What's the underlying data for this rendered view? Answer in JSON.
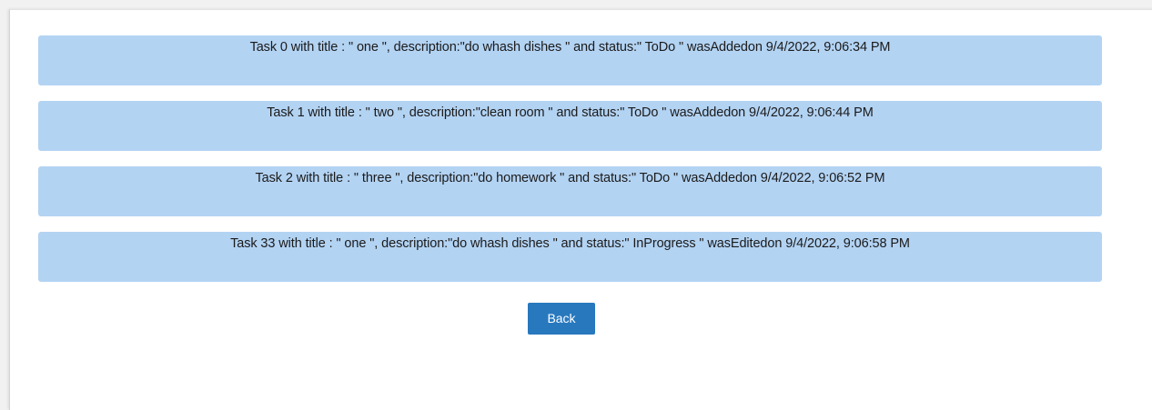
{
  "tasks": [
    {
      "text": "Task 0 with title : \" one \", description:\"do whash dishes \" and status:\" ToDo \" wasAddedon 9/4/2022, 9:06:34 PM"
    },
    {
      "text": "Task 1 with title : \" two \", description:\"clean room \" and status:\" ToDo \" wasAddedon 9/4/2022, 9:06:44 PM"
    },
    {
      "text": "Task 2 with title : \" three \", description:\"do homework \" and status:\" ToDo \" wasAddedon 9/4/2022, 9:06:52 PM"
    },
    {
      "text": "Task 33 with title : \" one \", description:\"do whash dishes \" and status:\" InProgress \" wasEditedon 9/4/2022, 9:06:58 PM"
    }
  ],
  "back_button": {
    "label": "Back"
  },
  "colors": {
    "task_background": "#b3d3f3",
    "button_background": "#2878be",
    "button_text": "#ffffff"
  }
}
